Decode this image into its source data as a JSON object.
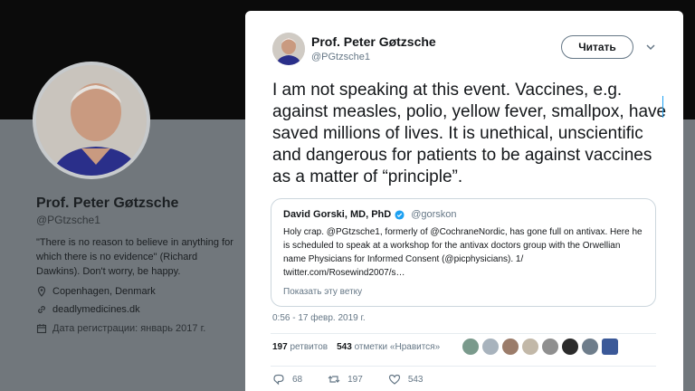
{
  "background_profile": {
    "name": "Prof. Peter Gøtzsche",
    "handle": "@PGtzsche1",
    "bio": "\"There is no reason to believe in anything for which there is no evidence\" (Richard Dawkins). Don't worry, be happy.",
    "location": "Copenhagen, Denmark",
    "website": "deadlymedicines.dk",
    "joined": "Дата регистрации: январь 2017 г."
  },
  "tweet": {
    "author_name": "Prof. Peter Gøtzsche",
    "author_handle": "@PGtzsche1",
    "follow_label": "Читать",
    "text": "I am not speaking at this event. Vaccines, e.g. against measles, polio, yellow fever, smallpox, have saved millions of lives. It is unethical, unscientific and dangerous for patients to be against vaccines as a matter of “principle”.",
    "timestamp": "0:56 - 17 февр. 2019 г.",
    "retweets_count": "197",
    "retweets_label": "ретвитов",
    "likes_count": "543",
    "likes_label": "отметки «Нравится»",
    "replies": "68",
    "retweets": "197",
    "likes": "543"
  },
  "quote": {
    "name": "David Gorski, MD, PhD",
    "handle": "@gorskon",
    "text": "Holy crap. @PGtzsche1, formerly of @CochraneNordic, has gone full on antivax. Here he is scheduled to speak at a workshop for the antivax doctors group with the Orwellian name Physicians for Informed Consent (@picphysicians). 1/ twitter.com/Rosewind2007/s…",
    "show_thread": "Показать эту ветку"
  },
  "colors": {
    "accent": "#1da1f2",
    "text": "#14171a",
    "muted": "#657786"
  },
  "icons": [
    "location-icon",
    "link-icon",
    "calendar-icon",
    "chevron-down-icon",
    "verified-icon",
    "reply-icon",
    "retweet-icon",
    "like-icon"
  ]
}
